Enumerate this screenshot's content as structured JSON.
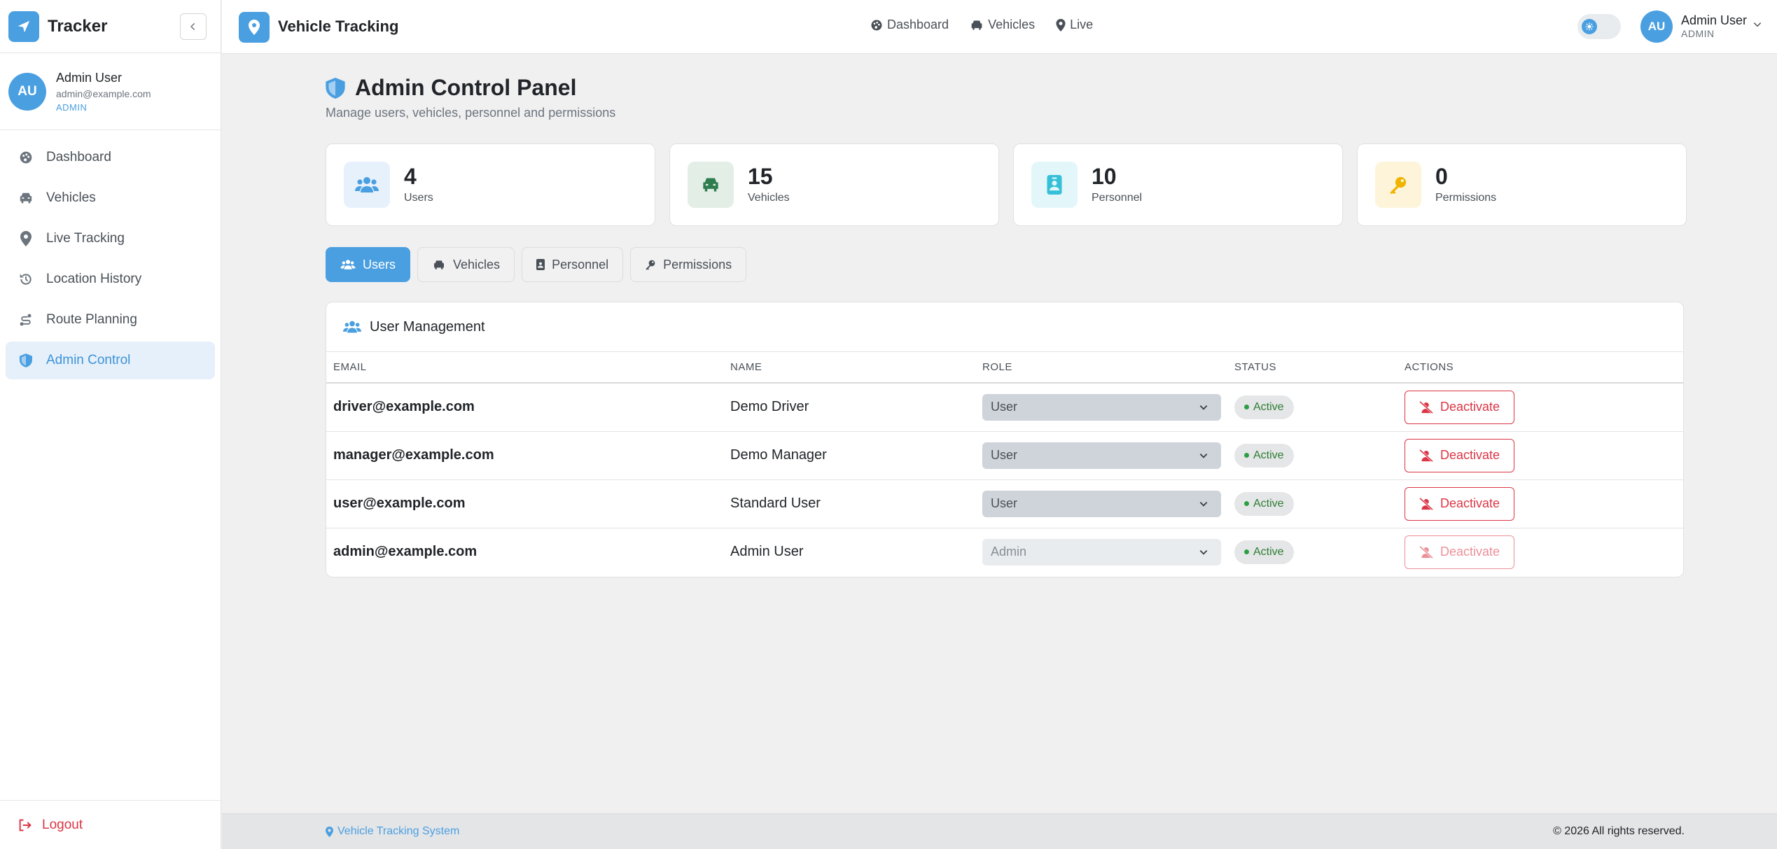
{
  "sidebar": {
    "brand": "Tracker",
    "user": {
      "initials": "AU",
      "name": "Admin User",
      "email": "admin@example.com",
      "role": "ADMIN"
    },
    "items": [
      {
        "label": "Dashboard",
        "icon": "palette-icon",
        "active": false
      },
      {
        "label": "Vehicles",
        "icon": "car-icon",
        "active": false
      },
      {
        "label": "Live Tracking",
        "icon": "map-pin-icon",
        "active": false
      },
      {
        "label": "Location History",
        "icon": "history-icon",
        "active": false
      },
      {
        "label": "Route Planning",
        "icon": "route-icon",
        "active": false
      },
      {
        "label": "Admin Control",
        "icon": "shield-icon",
        "active": true
      }
    ],
    "logout": "Logout"
  },
  "topbar": {
    "title": "Vehicle Tracking",
    "nav": [
      "Dashboard",
      "Vehicles",
      "Live"
    ],
    "user": {
      "initials": "AU",
      "name": "Admin User",
      "role": "ADMIN"
    }
  },
  "page": {
    "title": "Admin Control Panel",
    "subtitle": "Manage users, vehicles, personnel and permissions"
  },
  "stats": [
    {
      "value": "4",
      "label": "Users",
      "icon": "users-icon",
      "color": "#4a9fe1",
      "bg": "#e7f1fb"
    },
    {
      "value": "15",
      "label": "Vehicles",
      "icon": "car-icon",
      "color": "#2e7d4f",
      "bg": "#e3efe6"
    },
    {
      "value": "10",
      "label": "Personnel",
      "icon": "id-badge-icon",
      "color": "#35c0d8",
      "bg": "#e3f6fa"
    },
    {
      "value": "0",
      "label": "Permissions",
      "icon": "key-icon",
      "color": "#f0b400",
      "bg": "#fdf4da"
    }
  ],
  "tabs": [
    {
      "label": "Users",
      "icon": "users-icon",
      "active": true
    },
    {
      "label": "Vehicles",
      "icon": "car-icon",
      "active": false
    },
    {
      "label": "Personnel",
      "icon": "id-badge-icon",
      "active": false
    },
    {
      "label": "Permissions",
      "icon": "key-icon",
      "active": false
    }
  ],
  "table": {
    "title": "User Management",
    "columns": [
      "EMAIL",
      "NAME",
      "ROLE",
      "STATUS",
      "ACTIONS"
    ],
    "rows": [
      {
        "email": "driver@example.com",
        "name": "Demo Driver",
        "role": "User",
        "status": "Active",
        "action": "Deactivate",
        "disabled": false
      },
      {
        "email": "manager@example.com",
        "name": "Demo Manager",
        "role": "User",
        "status": "Active",
        "action": "Deactivate",
        "disabled": false
      },
      {
        "email": "user@example.com",
        "name": "Standard User",
        "role": "User",
        "status": "Active",
        "action": "Deactivate",
        "disabled": false
      },
      {
        "email": "admin@example.com",
        "name": "Admin User",
        "role": "Admin",
        "status": "Active",
        "action": "Deactivate",
        "disabled": true
      }
    ]
  },
  "footer": {
    "left": "Vehicle Tracking System",
    "right": "© 2026 All rights reserved."
  },
  "colors": {
    "accent": "#4a9fe1",
    "danger": "#dc3545",
    "success": "#2e9e44"
  }
}
